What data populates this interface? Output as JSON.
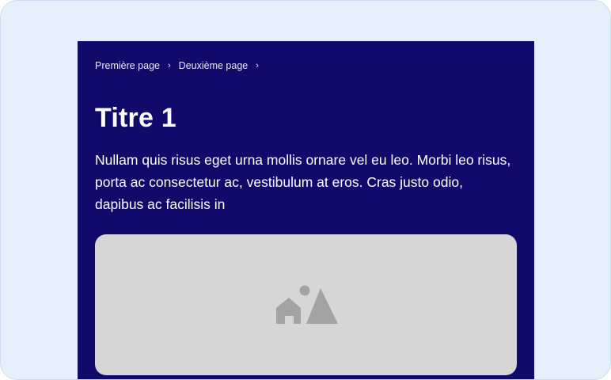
{
  "breadcrumb": {
    "items": [
      {
        "label": "Première page"
      },
      {
        "label": "Deuxième page"
      }
    ],
    "separator": "›"
  },
  "page": {
    "title": "Titre 1",
    "description": "Nullam quis risus eget urna mollis ornare vel eu leo. Morbi leo risus, porta ac consectetur ac, vestibulum at eros. Cras justo odio, dapibus ac facilisis in"
  },
  "image": {
    "icon": "image-placeholder-icon"
  },
  "colors": {
    "page_background": "#e6f0fb",
    "card_background": "#100a6b",
    "image_placeholder": "#d6d6d6",
    "icon_color": "#a3a3a3",
    "text": "#ffffff"
  }
}
